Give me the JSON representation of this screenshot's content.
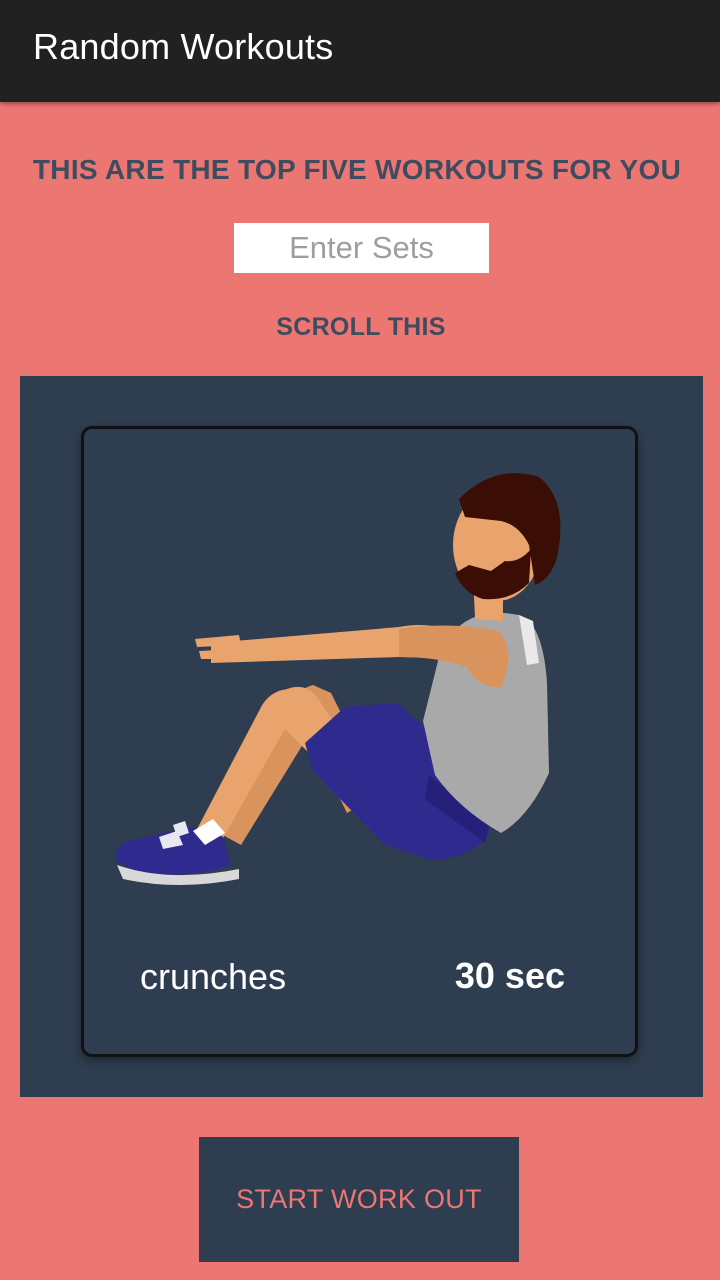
{
  "appbar": {
    "title": "Random Workouts"
  },
  "main": {
    "headline": "THIS ARE THE TOP FIVE WORKOUTS FOR YOU",
    "sets_input": {
      "placeholder": "Enter Sets",
      "value": ""
    },
    "scroll_label": "SCROLL THIS"
  },
  "workout_card": {
    "image_icon": "crunches-illustration",
    "name": "crunches",
    "duration": "30 sec"
  },
  "start_button": {
    "label": "START WORK OUT"
  },
  "colors": {
    "background": "#ec7672",
    "appbar": "#212121",
    "panel": "#2e3d50",
    "heading_text": "#3f4b5f",
    "button_text": "#ec7672"
  }
}
